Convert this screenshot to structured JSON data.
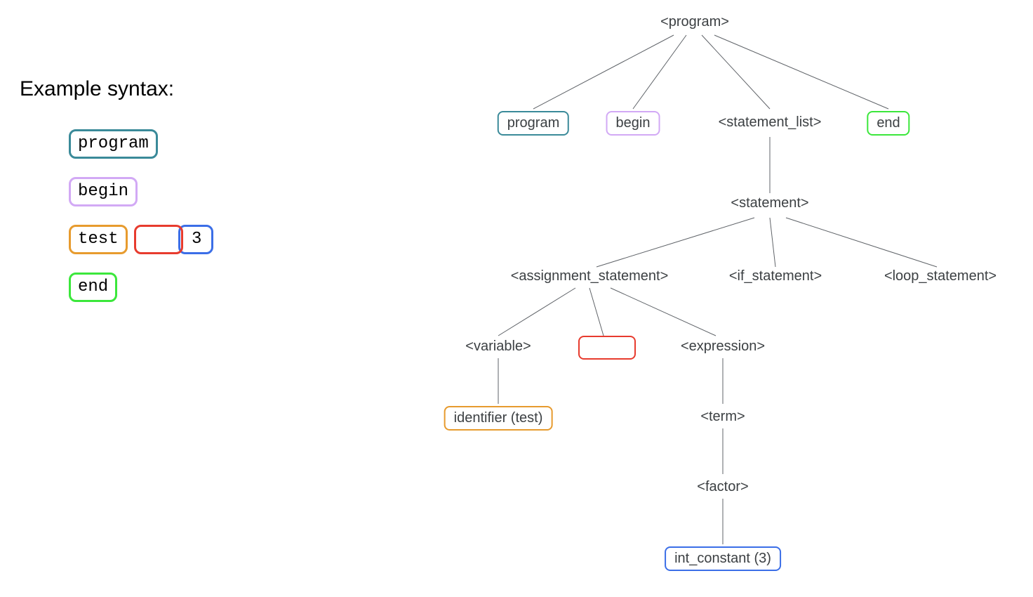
{
  "heading": "Example syntax:",
  "example": {
    "program": "program",
    "begin": "begin",
    "test": "test",
    "three": "3",
    "end": "end"
  },
  "colors": {
    "teal": "#3a8a99",
    "lavender": "#d2a9f5",
    "orange": "#e79b2e",
    "red": "#e73b2e",
    "blue": "#3b6ee7",
    "green": "#3be73b"
  },
  "tree": {
    "program_root": "<program>",
    "program_kw": "program",
    "begin_kw": "begin",
    "statement_list": "<statement_list>",
    "end_kw": "end",
    "statement": "<statement>",
    "assignment_statement": "<assignment_statement>",
    "if_statement": "<if_statement>",
    "loop_statement": "<loop_statement>",
    "variable": "<variable>",
    "expression": "<expression>",
    "identifier": "identifier (test)",
    "term": "<term>",
    "factor": "<factor>",
    "int_constant": "int_constant (3)"
  }
}
